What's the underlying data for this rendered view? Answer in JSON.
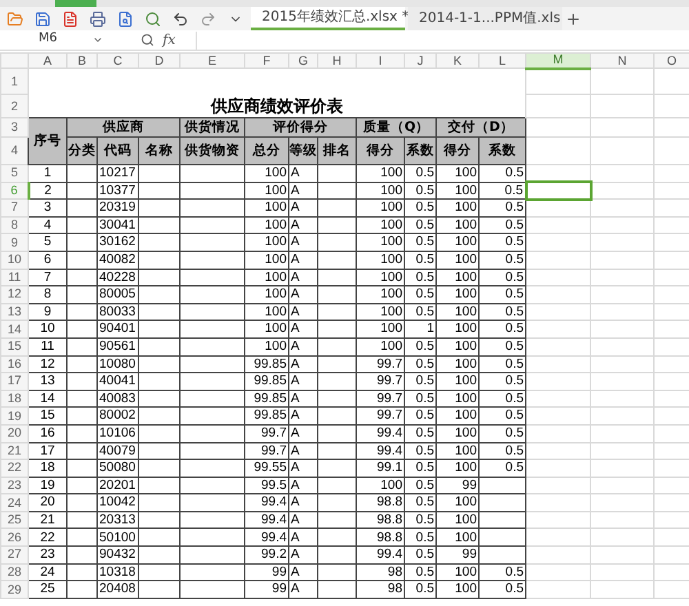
{
  "tabs": [
    {
      "label": "2015年绩效汇总.xlsx *",
      "selected": true
    },
    {
      "label": "2014-1-1...PPM值.xls",
      "selected": false
    }
  ],
  "formula_bar": {
    "cell_ref": "M6",
    "function_label": "fx"
  },
  "columns": [
    {
      "label": "A",
      "selected": false
    },
    {
      "label": "B",
      "selected": false
    },
    {
      "label": "C",
      "selected": false
    },
    {
      "label": "D",
      "selected": false
    },
    {
      "label": "E",
      "selected": false
    },
    {
      "label": "F",
      "selected": false
    },
    {
      "label": "G",
      "selected": false
    },
    {
      "label": "H",
      "selected": false
    },
    {
      "label": "I",
      "selected": false
    },
    {
      "label": "J",
      "selected": false
    },
    {
      "label": "K",
      "selected": false
    },
    {
      "label": "L",
      "selected": false
    },
    {
      "label": "M",
      "selected": true
    },
    {
      "label": "N",
      "selected": false
    },
    {
      "label": "O",
      "selected": false
    }
  ],
  "row_numbers": [
    {
      "label": "1",
      "selected": false
    },
    {
      "label": "2",
      "selected": false
    },
    {
      "label": "3",
      "selected": false
    },
    {
      "label": "4",
      "selected": false
    },
    {
      "label": "5",
      "selected": false
    },
    {
      "label": "6",
      "selected": true
    },
    {
      "label": "7",
      "selected": false
    },
    {
      "label": "8",
      "selected": false
    },
    {
      "label": "9",
      "selected": false
    },
    {
      "label": "10",
      "selected": false
    },
    {
      "label": "11",
      "selected": false
    },
    {
      "label": "12",
      "selected": false
    },
    {
      "label": "13",
      "selected": false
    },
    {
      "label": "14",
      "selected": false
    },
    {
      "label": "15",
      "selected": false
    },
    {
      "label": "16",
      "selected": false
    },
    {
      "label": "17",
      "selected": false
    },
    {
      "label": "18",
      "selected": false
    },
    {
      "label": "19",
      "selected": false
    },
    {
      "label": "20",
      "selected": false
    },
    {
      "label": "21",
      "selected": false
    },
    {
      "label": "22",
      "selected": false
    },
    {
      "label": "23",
      "selected": false
    },
    {
      "label": "24",
      "selected": false
    },
    {
      "label": "25",
      "selected": false
    },
    {
      "label": "26",
      "selected": false
    },
    {
      "label": "27",
      "selected": false
    },
    {
      "label": "28",
      "selected": false
    },
    {
      "label": "29",
      "selected": false
    }
  ],
  "title": "供应商绩效评价表",
  "header_row_1": [
    "序号",
    "供应商",
    "供货情况",
    "评价得分",
    "质量（Q）",
    "交付（D）"
  ],
  "header_row_2": [
    "分类",
    "代码",
    "名称",
    "供货物资",
    "总分",
    "等级",
    "排名",
    "得分",
    "系数",
    "得分",
    "系数"
  ],
  "data": [
    {
      "seq": "1",
      "code": "10217",
      "total": "100",
      "grade": "A",
      "q_score": "100",
      "q_coef": "0.5",
      "d_score": "100",
      "d_coef": "0.5"
    },
    {
      "seq": "2",
      "code": "10377",
      "total": "100",
      "grade": "A",
      "q_score": "100",
      "q_coef": "0.5",
      "d_score": "100",
      "d_coef": "0.5"
    },
    {
      "seq": "3",
      "code": "20319",
      "total": "100",
      "grade": "A",
      "q_score": "100",
      "q_coef": "0.5",
      "d_score": "100",
      "d_coef": "0.5"
    },
    {
      "seq": "4",
      "code": "30041",
      "total": "100",
      "grade": "A",
      "q_score": "100",
      "q_coef": "0.5",
      "d_score": "100",
      "d_coef": "0.5"
    },
    {
      "seq": "5",
      "code": "30162",
      "total": "100",
      "grade": "A",
      "q_score": "100",
      "q_coef": "0.5",
      "d_score": "100",
      "d_coef": "0.5"
    },
    {
      "seq": "6",
      "code": "40082",
      "total": "100",
      "grade": "A",
      "q_score": "100",
      "q_coef": "0.5",
      "d_score": "100",
      "d_coef": "0.5"
    },
    {
      "seq": "7",
      "code": "40228",
      "total": "100",
      "grade": "A",
      "q_score": "100",
      "q_coef": "0.5",
      "d_score": "100",
      "d_coef": "0.5"
    },
    {
      "seq": "8",
      "code": "80005",
      "total": "100",
      "grade": "A",
      "q_score": "100",
      "q_coef": "0.5",
      "d_score": "100",
      "d_coef": "0.5"
    },
    {
      "seq": "9",
      "code": "80033",
      "total": "100",
      "grade": "A",
      "q_score": "100",
      "q_coef": "0.5",
      "d_score": "100",
      "d_coef": "0.5"
    },
    {
      "seq": "10",
      "code": "90401",
      "total": "100",
      "grade": "A",
      "q_score": "100",
      "q_coef": "1",
      "d_score": "100",
      "d_coef": "0.5"
    },
    {
      "seq": "11",
      "code": "90561",
      "total": "100",
      "grade": "A",
      "q_score": "100",
      "q_coef": "0.5",
      "d_score": "100",
      "d_coef": "0.5"
    },
    {
      "seq": "12",
      "code": "10080",
      "total": "99.85",
      "grade": "A",
      "q_score": "99.7",
      "q_coef": "0.5",
      "d_score": "100",
      "d_coef": "0.5"
    },
    {
      "seq": "13",
      "code": "40041",
      "total": "99.85",
      "grade": "A",
      "q_score": "99.7",
      "q_coef": "0.5",
      "d_score": "100",
      "d_coef": "0.5"
    },
    {
      "seq": "14",
      "code": "40083",
      "total": "99.85",
      "grade": "A",
      "q_score": "99.7",
      "q_coef": "0.5",
      "d_score": "100",
      "d_coef": "0.5"
    },
    {
      "seq": "15",
      "code": "80002",
      "total": "99.85",
      "grade": "A",
      "q_score": "99.7",
      "q_coef": "0.5",
      "d_score": "100",
      "d_coef": "0.5"
    },
    {
      "seq": "16",
      "code": "10106",
      "total": "99.7",
      "grade": "A",
      "q_score": "99.4",
      "q_coef": "0.5",
      "d_score": "100",
      "d_coef": "0.5"
    },
    {
      "seq": "17",
      "code": "40079",
      "total": "99.7",
      "grade": "A",
      "q_score": "99.4",
      "q_coef": "0.5",
      "d_score": "100",
      "d_coef": "0.5"
    },
    {
      "seq": "18",
      "code": "50080",
      "total": "99.55",
      "grade": "A",
      "q_score": "99.1",
      "q_coef": "0.5",
      "d_score": "100",
      "d_coef": "0.5"
    },
    {
      "seq": "19",
      "code": "20201",
      "total": "99.5",
      "grade": "A",
      "q_score": "100",
      "q_coef": "0.5",
      "d_score": "99"
    },
    {
      "seq": "20",
      "code": "10042",
      "total": "99.4",
      "grade": "A",
      "q_score": "98.8",
      "q_coef": "0.5",
      "d_score": "100"
    },
    {
      "seq": "21",
      "code": "20313",
      "total": "99.4",
      "grade": "A",
      "q_score": "98.8",
      "q_coef": "0.5",
      "d_score": "100"
    },
    {
      "seq": "22",
      "code": "50100",
      "total": "99.4",
      "grade": "A",
      "q_score": "98.8",
      "q_coef": "0.5",
      "d_score": "100"
    },
    {
      "seq": "23",
      "code": "90432",
      "total": "99.2",
      "grade": "A",
      "q_score": "99.4",
      "q_coef": "0.5",
      "d_score": "99"
    },
    {
      "seq": "24",
      "code": "10318",
      "total": "99",
      "grade": "A",
      "q_score": "98",
      "q_coef": "0.5",
      "d_score": "100",
      "d_coef": "0.5"
    },
    {
      "seq": "25",
      "code": "20408",
      "total": "99",
      "grade": "A",
      "q_score": "98",
      "q_coef": "0.5",
      "d_score": "100",
      "d_coef": "0.5"
    }
  ]
}
